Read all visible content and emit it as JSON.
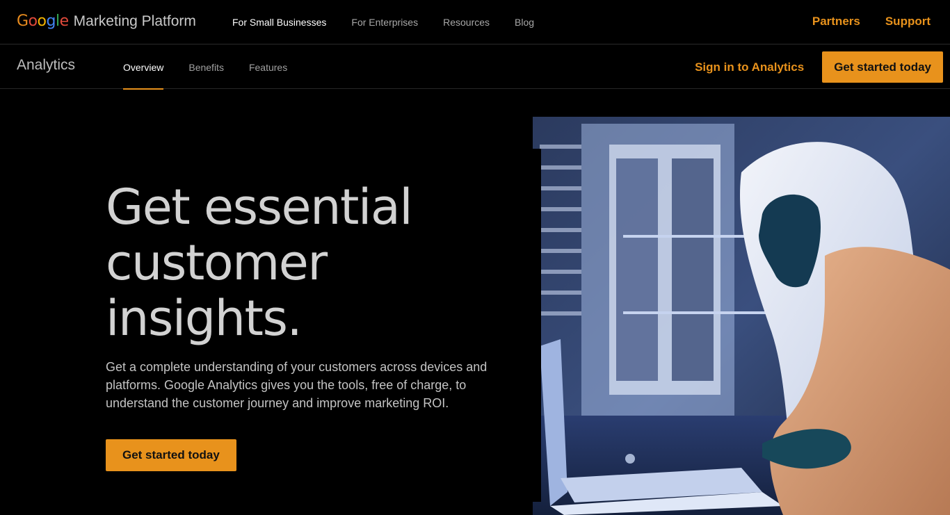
{
  "brand": {
    "google_letters": [
      {
        "ch": "G",
        "color": "#e88b1e"
      },
      {
        "ch": "o",
        "color": "#e24a3b"
      },
      {
        "ch": "o",
        "color": "#f4b400"
      },
      {
        "ch": "g",
        "color": "#4285f4"
      },
      {
        "ch": "l",
        "color": "#34a853"
      },
      {
        "ch": "e",
        "color": "#e24a3b"
      }
    ],
    "rest": "Marketing Platform"
  },
  "topnav": {
    "items": [
      {
        "label": "For Small Businesses",
        "active": true
      },
      {
        "label": "For Enterprises",
        "active": false
      },
      {
        "label": "Resources",
        "active": false
      },
      {
        "label": "Blog",
        "active": false
      }
    ],
    "partners": "Partners",
    "support": "Support"
  },
  "subnav": {
    "product": "Analytics",
    "tabs": [
      {
        "label": "Overview",
        "active": true
      },
      {
        "label": "Benefits",
        "active": false
      },
      {
        "label": "Features",
        "active": false
      }
    ],
    "signin": "Sign in to Analytics",
    "cta": "Get started today"
  },
  "hero": {
    "title_lines": [
      "Get essential",
      "customer",
      "insights."
    ],
    "body": "Get a complete understanding of your customers across devices and platforms. Google Analytics gives you the tools, free of charge, to understand the customer journey and improve marketing ROI.",
    "cta": "Get started today"
  },
  "colors": {
    "accent": "#e8921c",
    "background": "#000000"
  }
}
